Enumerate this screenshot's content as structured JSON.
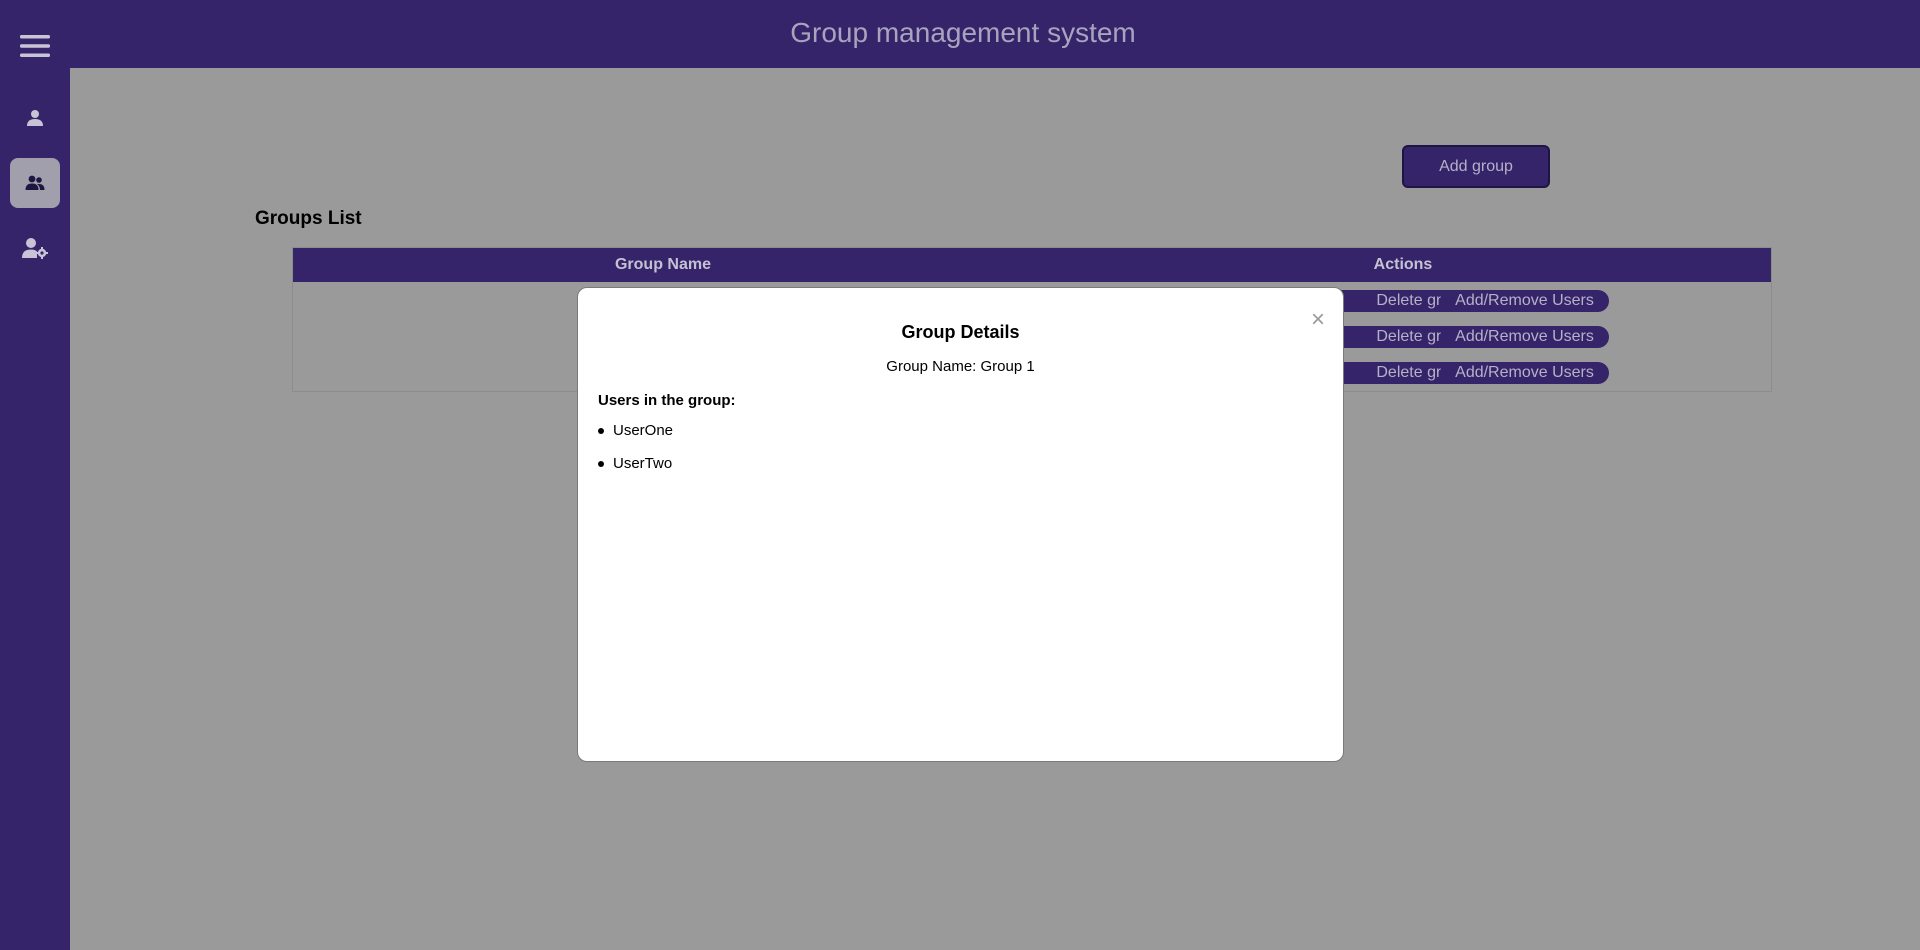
{
  "app": {
    "title": "Group management system"
  },
  "sidebar": {
    "items": [
      {
        "icon": "hamburger-menu-icon"
      },
      {
        "icon": "user-icon"
      },
      {
        "icon": "users-group-icon",
        "active": true
      },
      {
        "icon": "user-settings-icon"
      }
    ]
  },
  "toolbar": {
    "add_group_label": "Add group"
  },
  "groups": {
    "title": "Groups List",
    "columns": [
      "Group Name",
      "Actions"
    ],
    "rows": [
      {
        "delete_label": "Delete group",
        "add_remove_label": "Add/Remove Users"
      },
      {
        "delete_label": "Delete group",
        "add_remove_label": "Add/Remove Users"
      },
      {
        "delete_label": "Delete group",
        "add_remove_label": "Add/Remove Users"
      }
    ]
  },
  "modal": {
    "title": "Group Details",
    "group_name_line": "Group Name: Group 1",
    "users_label": "Users in the group:",
    "users": [
      "UserOne",
      "UserTwo"
    ],
    "close_symbol": "×"
  },
  "colors": {
    "brand": "#35246a",
    "overlay_bg": "#9a9a9a",
    "active_sidebar": "#a19fac"
  }
}
